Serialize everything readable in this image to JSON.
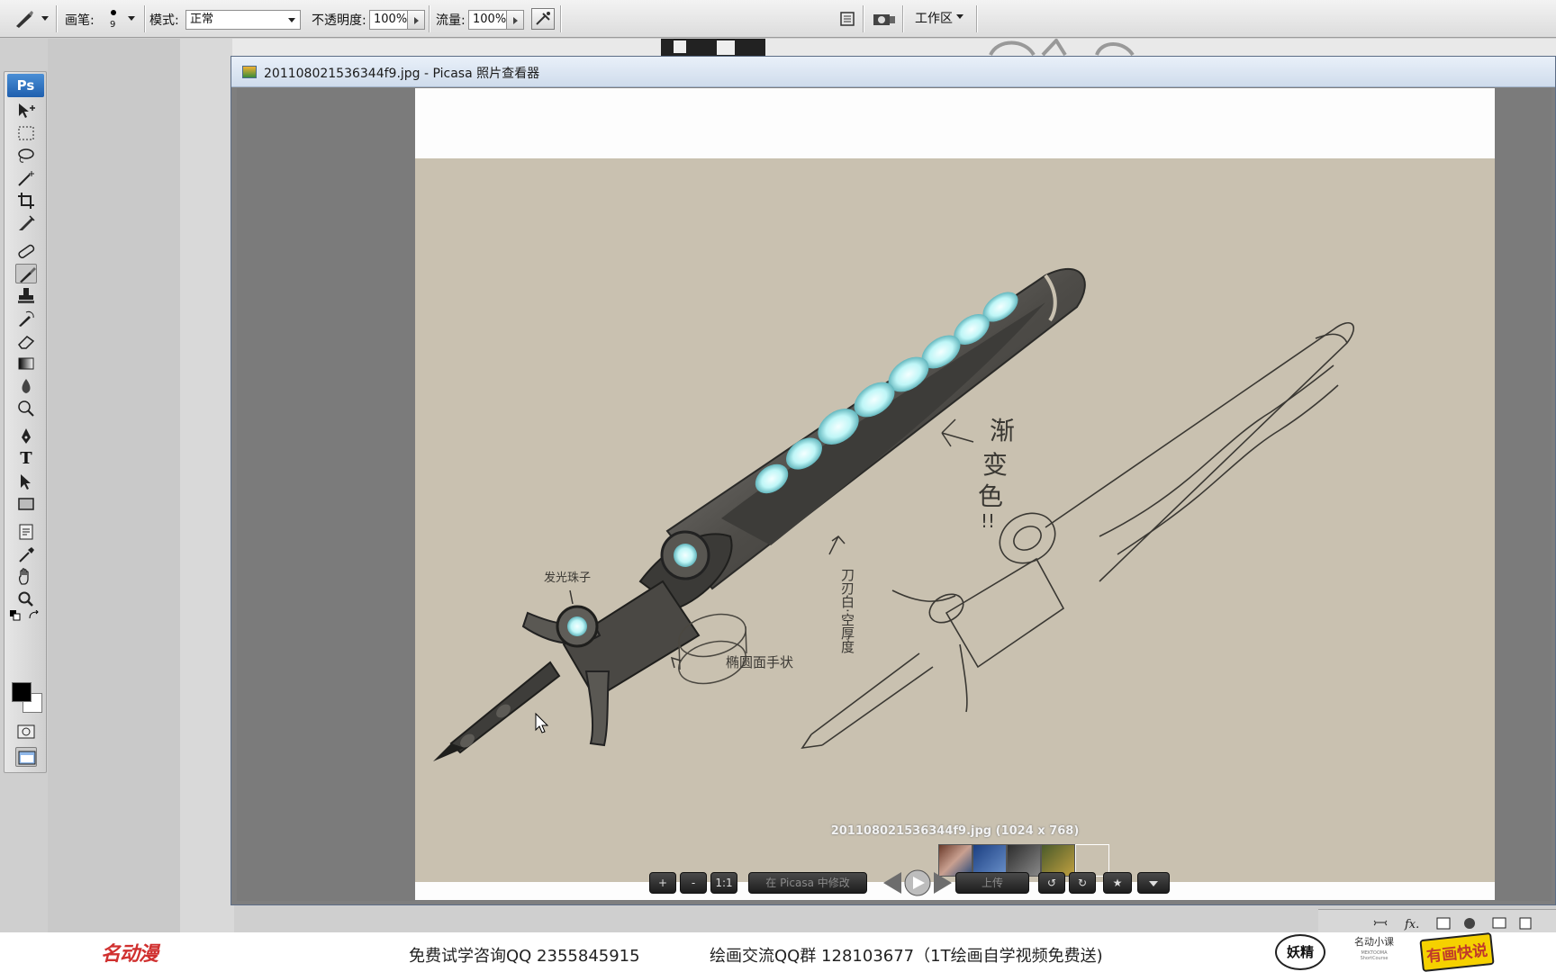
{
  "options_bar": {
    "brush_label": "画笔:",
    "brush_size": "9",
    "mode_label": "模式:",
    "mode_value": "正常",
    "opacity_label": "不透明度:",
    "opacity_value": "100%",
    "flow_label": "流量:",
    "flow_value": "100%",
    "workspace_label": "工作区"
  },
  "toolbox": {
    "logo": "Ps",
    "tools": [
      "move",
      "marquee",
      "lasso",
      "magic-wand",
      "crop",
      "slice",
      "healing-brush",
      "brush",
      "clone-stamp",
      "history-brush",
      "eraser",
      "gradient",
      "blur",
      "dodge",
      "pen",
      "type",
      "path-selection",
      "shape",
      "notes",
      "eyedropper",
      "hand",
      "zoom"
    ],
    "type_tool_glyph": "T",
    "selected_tool": "brush"
  },
  "picasa": {
    "title": "201108021536344f9.jpg - Picasa 照片查看器",
    "file_info": "201108021536344f9.jpg (1024 x 768)",
    "controls": {
      "zoom_in": "+",
      "zoom_out": "-",
      "actual_size": "1:1",
      "edit_in_picasa": "在 Picasa 中修改",
      "upload": "上传",
      "rotate_left": "↺",
      "rotate_right": "↻",
      "star": "★"
    }
  },
  "artwork": {
    "notes": {
      "gem_note": "发光珠子",
      "color_note_1": "渐",
      "color_note_2": "变",
      "color_note_3": "色",
      "color_note_4": "!!",
      "blade_note": "刀刃白·空厚度",
      "grip_note": "椭圆面手状"
    }
  },
  "banner": {
    "brand": "名动漫",
    "consult": "免费试学咨询QQ 2355845915",
    "group": "绘画交流QQ群 128103677（1T绘画自学视频免费送)",
    "logo_a": "妖精",
    "logo_b": "名动小课",
    "logo_b_sub": "MEKTOOMA ShortCourse",
    "logo_c": "有画快说"
  },
  "colors": {
    "ps_blue": "#1f5fae",
    "picasa_title": "#cfdcec",
    "paper": "#c9c1b0",
    "brand_red": "#d0302f",
    "gem_cyan": "#bff6f7"
  }
}
